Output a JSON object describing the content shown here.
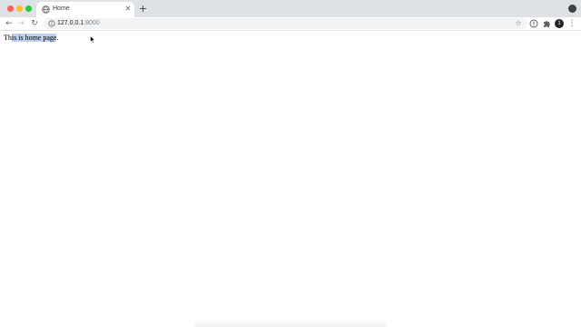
{
  "window": {
    "controls": [
      "close-button",
      "minimize-button",
      "maximize-button"
    ]
  },
  "tabs": [
    {
      "title": "Home",
      "icon": "globe-icon",
      "close_glyph": "✕",
      "active": true
    }
  ],
  "new_tab_glyph": "+",
  "toolbar": {
    "back_glyph": "←",
    "forward_glyph": "→",
    "reload_glyph": "↻",
    "url_host": "127.0.0.1",
    "url_port": ":8000",
    "bookmark_glyph": "☆",
    "profile_initial": "1",
    "menu_glyph": "⋮"
  },
  "page": {
    "text_before": "Th",
    "text_selected": "is is home page",
    "text_after": "."
  },
  "colors": {
    "tabstrip": "#dee1e6",
    "selection": "#bcd1ef",
    "omnibox": "#f1f3f4"
  }
}
